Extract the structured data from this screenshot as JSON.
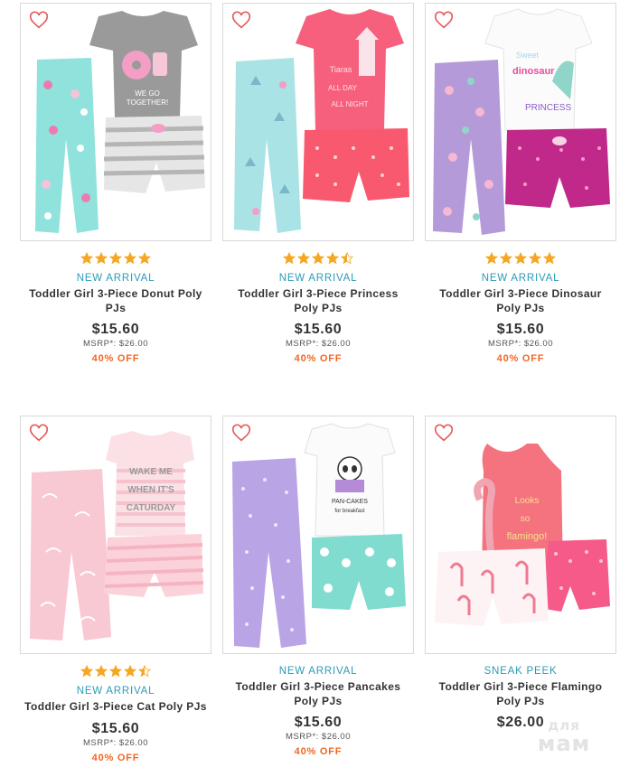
{
  "colors": {
    "accent_teal": "#2a9bb6",
    "sale_orange": "#f26722",
    "star_orange": "#f5a623",
    "heart_red": "#e65a5a"
  },
  "icons": {
    "favorite": "heart-outline-icon",
    "rating": "star-icon"
  },
  "products": [
    {
      "flag": "NEW ARRIVAL",
      "title": "Toddler Girl 3-Piece Donut Poly PJs",
      "price": "$15.60",
      "msrp": "MSRP*: $26.00",
      "discount": "40% OFF",
      "rating": 5
    },
    {
      "flag": "NEW ARRIVAL",
      "title": "Toddler Girl 3-Piece Princess Poly PJs",
      "price": "$15.60",
      "msrp": "MSRP*: $26.00",
      "discount": "40% OFF",
      "rating": 4.5
    },
    {
      "flag": "NEW ARRIVAL",
      "title": "Toddler Girl 3-Piece Dinosaur Poly PJs",
      "price": "$15.60",
      "msrp": "MSRP*: $26.00",
      "discount": "40% OFF",
      "rating": 5
    },
    {
      "flag": "NEW ARRIVAL",
      "title": "Toddler Girl 3-Piece Cat Poly PJs",
      "price": "$15.60",
      "msrp": "MSRP*: $26.00",
      "discount": "40% OFF",
      "rating": 4.5
    },
    {
      "flag": "NEW ARRIVAL",
      "title": "Toddler Girl 3-Piece Pancakes Poly PJs",
      "price": "$15.60",
      "msrp": "MSRP*: $26.00",
      "discount": "40% OFF",
      "rating": 0
    },
    {
      "flag": "SNEAK PEEK",
      "title": "Toddler Girl 3-Piece Flamingo Poly PJs",
      "price": "$26.00",
      "msrp": "",
      "discount": "",
      "rating": 0
    }
  ],
  "watermark": {
    "line1": "для",
    "line2": "мам"
  }
}
